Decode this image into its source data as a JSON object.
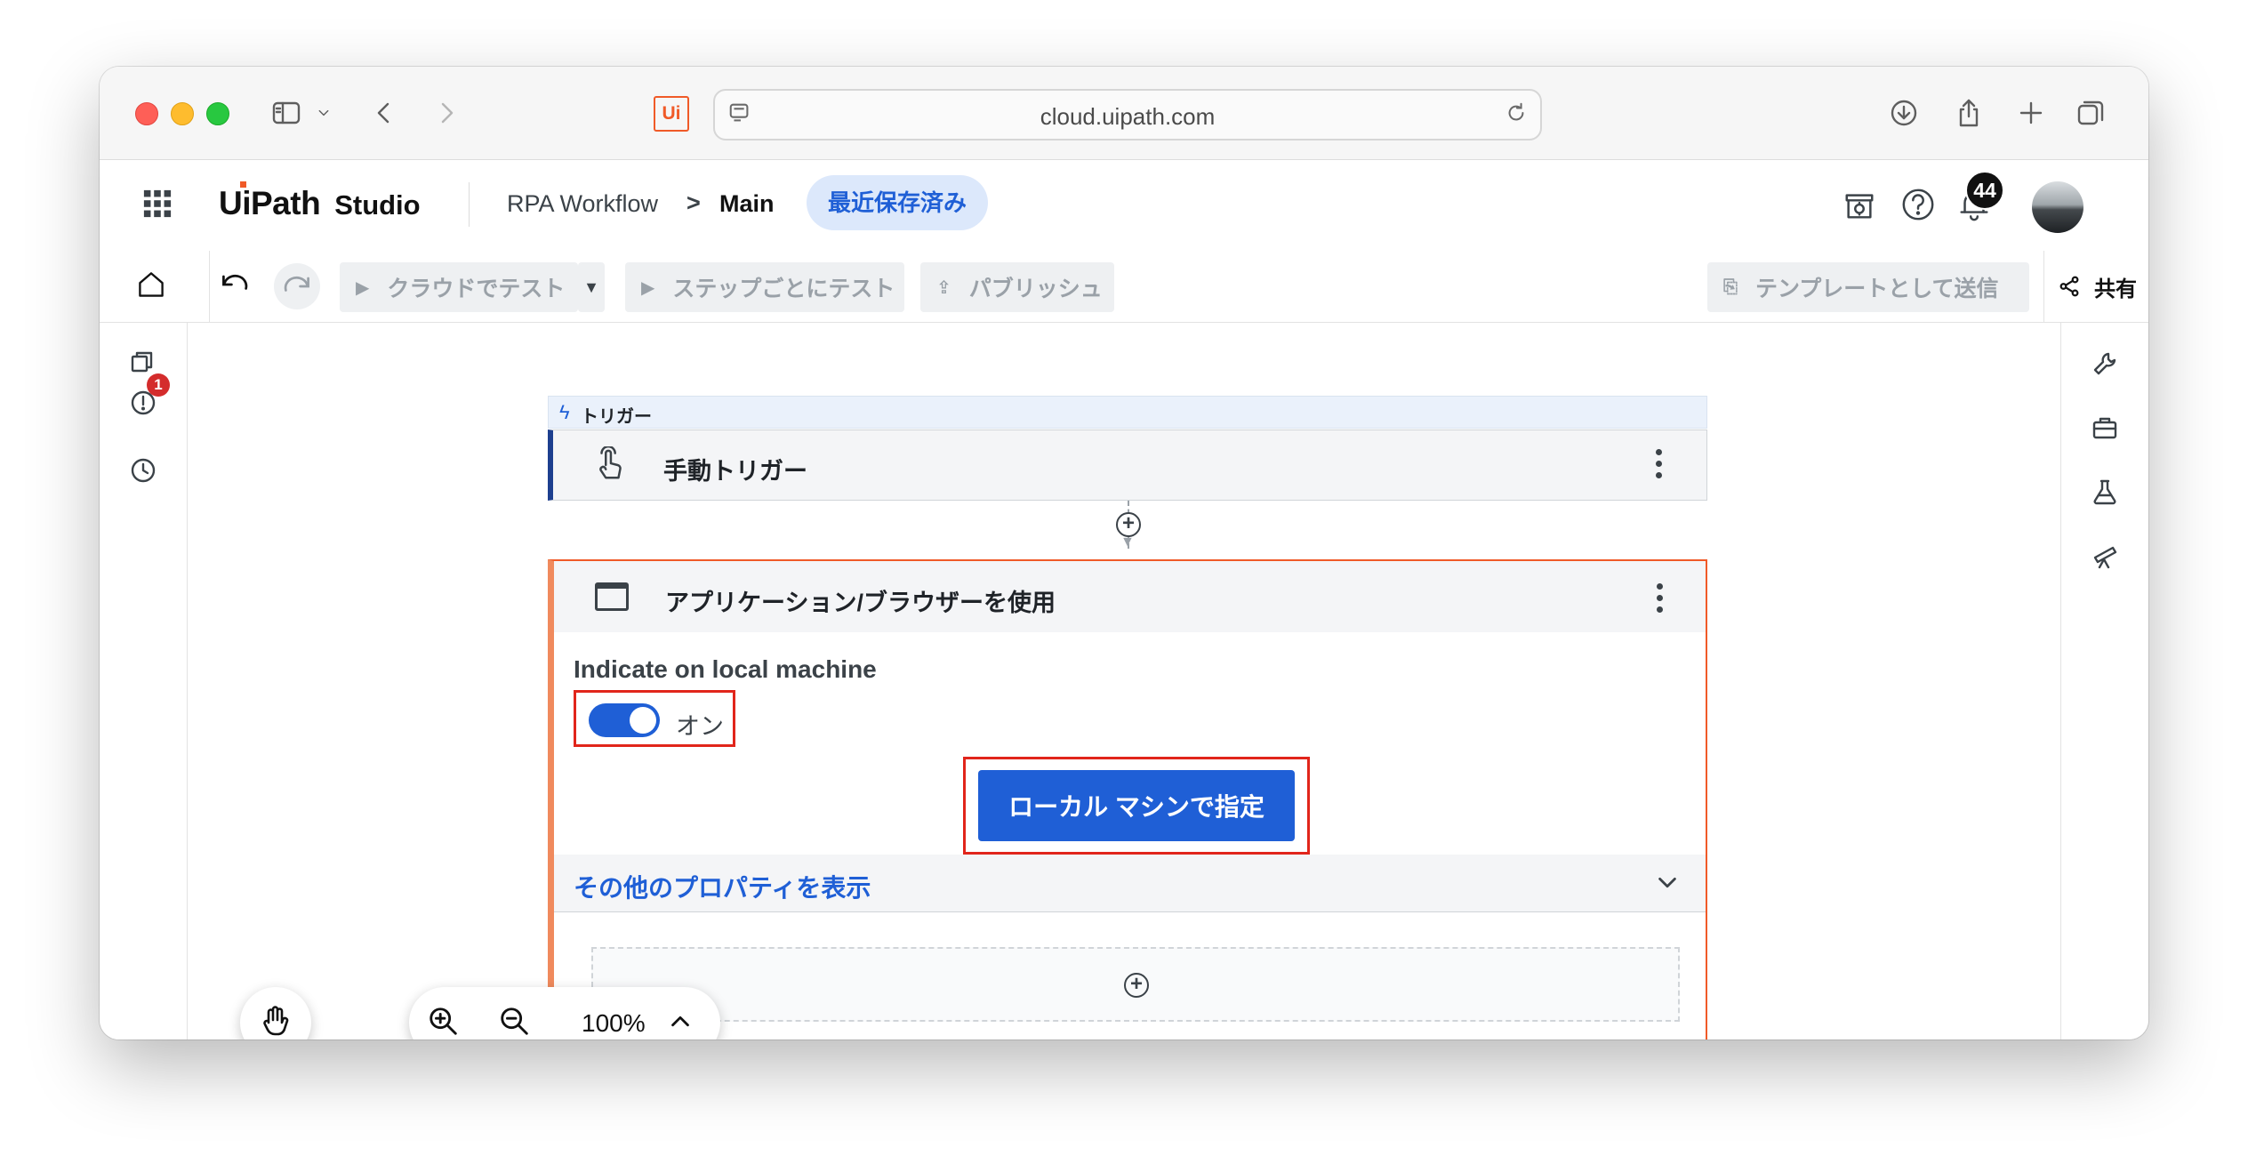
{
  "browser": {
    "url": "cloud.uipath.com",
    "site_logo": "Ui"
  },
  "header": {
    "brand_logo": "UiPath",
    "brand_product": "Studio",
    "breadcrumb_project": "RPA Workflow",
    "breadcrumb_sep": ">",
    "breadcrumb_current": "Main",
    "save_status": "最近保存済み",
    "notification_count": "44"
  },
  "toolbar": {
    "test_cloud": "クラウドでテスト",
    "test_step": "ステップごとにテスト",
    "publish": "パブリッシュ",
    "send_template": "テンプレートとして送信",
    "share": "共有"
  },
  "left_rail": {
    "error_badge": "1"
  },
  "canvas": {
    "trigger_band_label": "トリガー",
    "trigger_title": "手動トリガー",
    "activity_title": "アプリケーション/ブラウザーを使用",
    "indicate_label": "Indicate on local machine",
    "toggle_state": "オン",
    "toggle_on": true,
    "indicate_button": "ローカル マシンで指定",
    "more_properties": "その他のプロパティを表示"
  },
  "zoom": {
    "level": "100%"
  },
  "colors": {
    "accent_blue": "#1f5fd6",
    "uipath_orange": "#f05a28",
    "highlight_red": "#e1251b",
    "trigger_bar": "#1d3f8f"
  }
}
